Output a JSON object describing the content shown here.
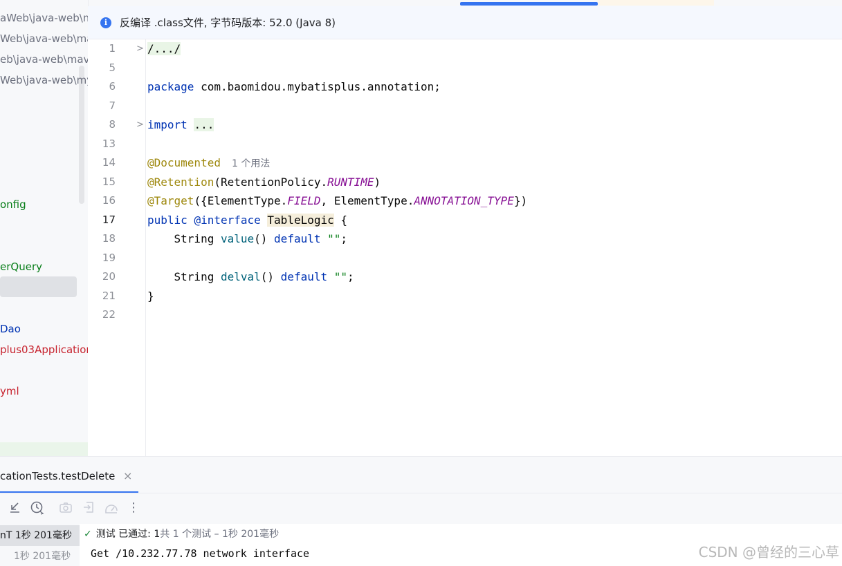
{
  "project_tree": {
    "rows": [
      {
        "text": "aWeb\\java-web\\m",
        "color": "#6c707e"
      },
      {
        "text": "Web\\java-web\\mav",
        "color": "#6c707e"
      },
      {
        "text": "eb\\java-web\\mav",
        "color": "#6c707e"
      },
      {
        "text": "Web\\java-web\\myb",
        "color": "#6c707e"
      },
      {
        "text": "onfig",
        "color": "#067d17"
      },
      {
        "text": "erQuery",
        "color": "#067d17"
      },
      {
        "text": "Dao",
        "color": "#0033b3"
      },
      {
        "text": "plus03Application",
        "color": "#c7222d"
      },
      {
        "text": "yml",
        "color": "#c7222d"
      }
    ]
  },
  "banner": {
    "icon": "info-icon",
    "text": "反编译 .class文件, 字节码版本: 52.0 (Java 8)"
  },
  "editor": {
    "line_numbers": [
      "1",
      "5",
      "6",
      "7",
      "8",
      "13",
      "14",
      "15",
      "16",
      "17",
      "18",
      "19",
      "20",
      "21",
      "22"
    ],
    "current_line": "17",
    "folded_import_text": "...",
    "header_fold_text": "/.../",
    "package_kw": "package",
    "package_name": "com.baomidou.mybatisplus.annotation;",
    "import_kw": "import",
    "ann_documented": "@Documented",
    "usage_hint": "1 个用法",
    "ann_retention": "@Retention",
    "retention_arg_prefix": "(RetentionPolicy.",
    "retention_field": "RUNTIME",
    "retention_suffix": ")",
    "ann_target": "@Target",
    "target_prefix": "({ElementType.",
    "target_field1": "FIELD",
    "target_mid": ", ElementType.",
    "target_field2": "ANNOTATION_TYPE",
    "target_suffix": "})",
    "public_kw": "public",
    "interface_kw": "@interface",
    "class_name": "TableLogic",
    "open_brace": "{",
    "type_string": "String",
    "method1": "value",
    "method2": "delval",
    "parens": "()",
    "default_kw": "default",
    "empty_str": "\"\"",
    "semicolon": ";",
    "close_brace": "}"
  },
  "run_panel": {
    "tab_label": "cationTests.testDelete",
    "close_glyph": "×",
    "toolbar_icons": [
      "collapse-icon",
      "history-icon",
      "camera-icon",
      "export-icon",
      "gauge-icon",
      "more-icon"
    ],
    "test_tree_row1": "nT  1秒 201毫秒",
    "test_tree_row2": "1秒 201毫秒",
    "status_label": "测试 已通过: ",
    "status_count": "1",
    "status_extra": "共 1 个测试 – 1秒 201毫秒",
    "console_output": "Get /10.232.77.78 network interface"
  },
  "watermark": "CSDN @曾经的三心草"
}
